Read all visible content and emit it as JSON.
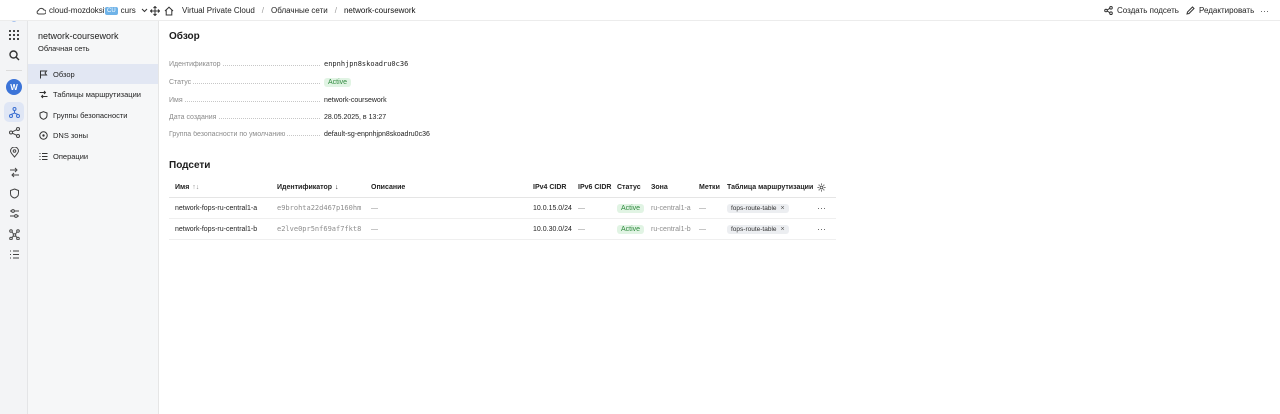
{
  "topbar": {
    "cloud_name": "cloud-mozdoksity",
    "folder_badge": "CU",
    "folder_name": "curs",
    "breadcrumbs": [
      "Virtual Private Cloud",
      "Облачные сети",
      "network-coursework"
    ],
    "separator": "/",
    "create_subnet_label": "Создать подсеть",
    "edit_label": "Редактировать",
    "more_label": "···"
  },
  "rail": {
    "avatar_letter": "W"
  },
  "sidebar": {
    "title": "network-coursework",
    "subtitle": "Облачная сеть",
    "items": [
      {
        "label": "Обзор",
        "icon": "flag-icon"
      },
      {
        "label": "Таблицы маршрутизации",
        "icon": "route-icon"
      },
      {
        "label": "Группы безопасности",
        "icon": "shield-icon"
      },
      {
        "label": "DNS зоны",
        "icon": "globe-icon"
      },
      {
        "label": "Операции",
        "icon": "list-icon"
      }
    ]
  },
  "overview": {
    "title": "Обзор",
    "id_label": "Идентификатор",
    "id_value": "enpnhjpn8skoadru0c36",
    "status_label": "Статус",
    "status_value": "Active",
    "name_label": "Имя",
    "name_value": "network-coursework",
    "created_label": "Дата создания",
    "created_value": "28.05.2025, в 13:27",
    "secgroup_label": "Группа безопасности по умолчанию",
    "secgroup_value": "default-sg-enpnhjpn8skoadru0c36"
  },
  "subnets": {
    "title": "Подсети",
    "columns": {
      "name": "Имя",
      "name_sort": "↑↓",
      "id": "Идентификатор",
      "id_sort": "↓",
      "description": "Описание",
      "ipv4": "IPv4 CIDR",
      "ipv6": "IPv6 CIDR",
      "status": "Статус",
      "zone": "Зона",
      "labels": "Метки",
      "route_table": "Таблица маршрутизации"
    },
    "rows": [
      {
        "name": "network-fops-ru-central1-a",
        "id": "e9brohta22d467p160hm",
        "description": "—",
        "ipv4": "10.0.15.0/24",
        "ipv6": "—",
        "status": "Active",
        "zone": "ru-central1-a",
        "labels": "—",
        "route_table": "fops-route-table",
        "more": "···"
      },
      {
        "name": "network-fops-ru-central1-b",
        "id": "e2lve0pr5nf69af7fkt8",
        "description": "—",
        "ipv4": "10.0.30.0/24",
        "ipv6": "—",
        "status": "Active",
        "zone": "ru-central1-b",
        "labels": "—",
        "route_table": "fops-route-table",
        "more": "···"
      }
    ],
    "remove_tag": "×"
  },
  "colors": {
    "accent": "#3b6fd1",
    "status_active_bg": "#e1f4e4",
    "status_active_text": "#2f8a3e",
    "sidebar_active": "#e2e7f3"
  }
}
